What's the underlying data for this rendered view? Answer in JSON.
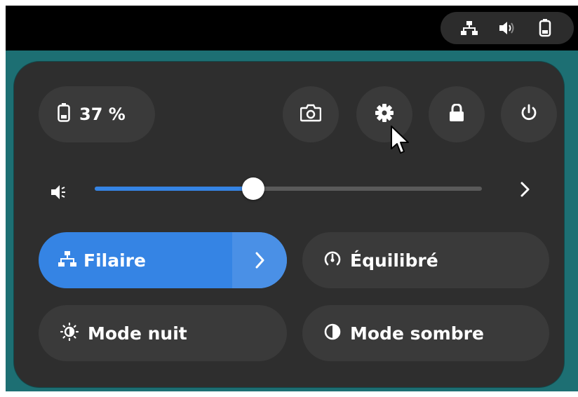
{
  "topbar": {
    "tray_icons": [
      "network-wired-icon",
      "speaker-icon",
      "battery-icon"
    ]
  },
  "quick_settings": {
    "battery": {
      "label": "37 %",
      "icon": "battery-icon"
    },
    "actions": [
      {
        "name": "screenshot",
        "icon": "camera-icon"
      },
      {
        "name": "settings",
        "icon": "gear-icon"
      },
      {
        "name": "lock",
        "icon": "lock-icon"
      },
      {
        "name": "power",
        "icon": "power-icon"
      }
    ],
    "volume": {
      "level_percent": 41,
      "icon": "speaker-low-icon",
      "more_icon": "chevron-right-icon"
    },
    "toggles": {
      "wired": {
        "label": "Filaire",
        "active": true
      },
      "power_mode": {
        "label": "Équilibré"
      },
      "night_mode": {
        "label": "Mode nuit"
      },
      "dark_mode": {
        "label": "Mode sombre"
      }
    }
  },
  "colors": {
    "accent": "#3584e4",
    "panel": "#2e2e2e",
    "button": "#3a3a3a",
    "desktop": "#1d6f73"
  }
}
